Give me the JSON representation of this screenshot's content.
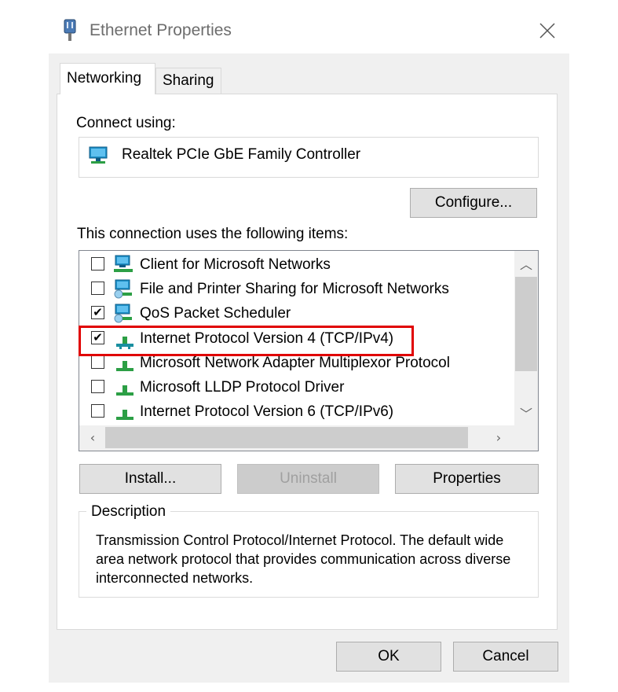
{
  "window": {
    "title": "Ethernet Properties",
    "title_icon": "network-plug-icon",
    "close_icon": "close-icon"
  },
  "tabs": [
    {
      "label": "Networking",
      "selected": true
    },
    {
      "label": "Sharing",
      "selected": false
    }
  ],
  "connect": {
    "label": "Connect using:",
    "adapter_name": "Realtek PCIe GbE Family Controller",
    "adapter_icon": "network-adapter-icon",
    "configure_label": "Configure..."
  },
  "items": {
    "label": "This connection uses the following items:",
    "list": [
      {
        "label": "Client for Microsoft Networks",
        "checked": false,
        "icon": "network-client-icon"
      },
      {
        "label": "File and Printer Sharing for Microsoft Networks",
        "checked": false,
        "icon": "network-service-icon"
      },
      {
        "label": "QoS Packet Scheduler",
        "checked": true,
        "icon": "network-service-icon"
      },
      {
        "label": "Internet Protocol Version 4 (TCP/IPv4)",
        "checked": true,
        "icon": "protocol-icon",
        "highlighted": true
      },
      {
        "label": "Microsoft Network Adapter Multiplexor Protocol",
        "checked": false,
        "icon": "protocol-icon"
      },
      {
        "label": "Microsoft LLDP Protocol Driver",
        "checked": false,
        "icon": "protocol-icon"
      },
      {
        "label": "Internet Protocol Version 6 (TCP/IPv6)",
        "checked": false,
        "icon": "protocol-icon"
      }
    ]
  },
  "buttons": {
    "install": "Install...",
    "uninstall": "Uninstall",
    "uninstall_enabled": false,
    "properties": "Properties",
    "ok": "OK",
    "cancel": "Cancel"
  },
  "description": {
    "legend": "Description",
    "text": "Transmission Control Protocol/Internet Protocol. The default wide area network protocol that provides communication across diverse interconnected networks."
  },
  "colors": {
    "highlight": "#e00000",
    "dialog_bg": "#f0f0f0",
    "title_text": "#6d6d6d"
  }
}
